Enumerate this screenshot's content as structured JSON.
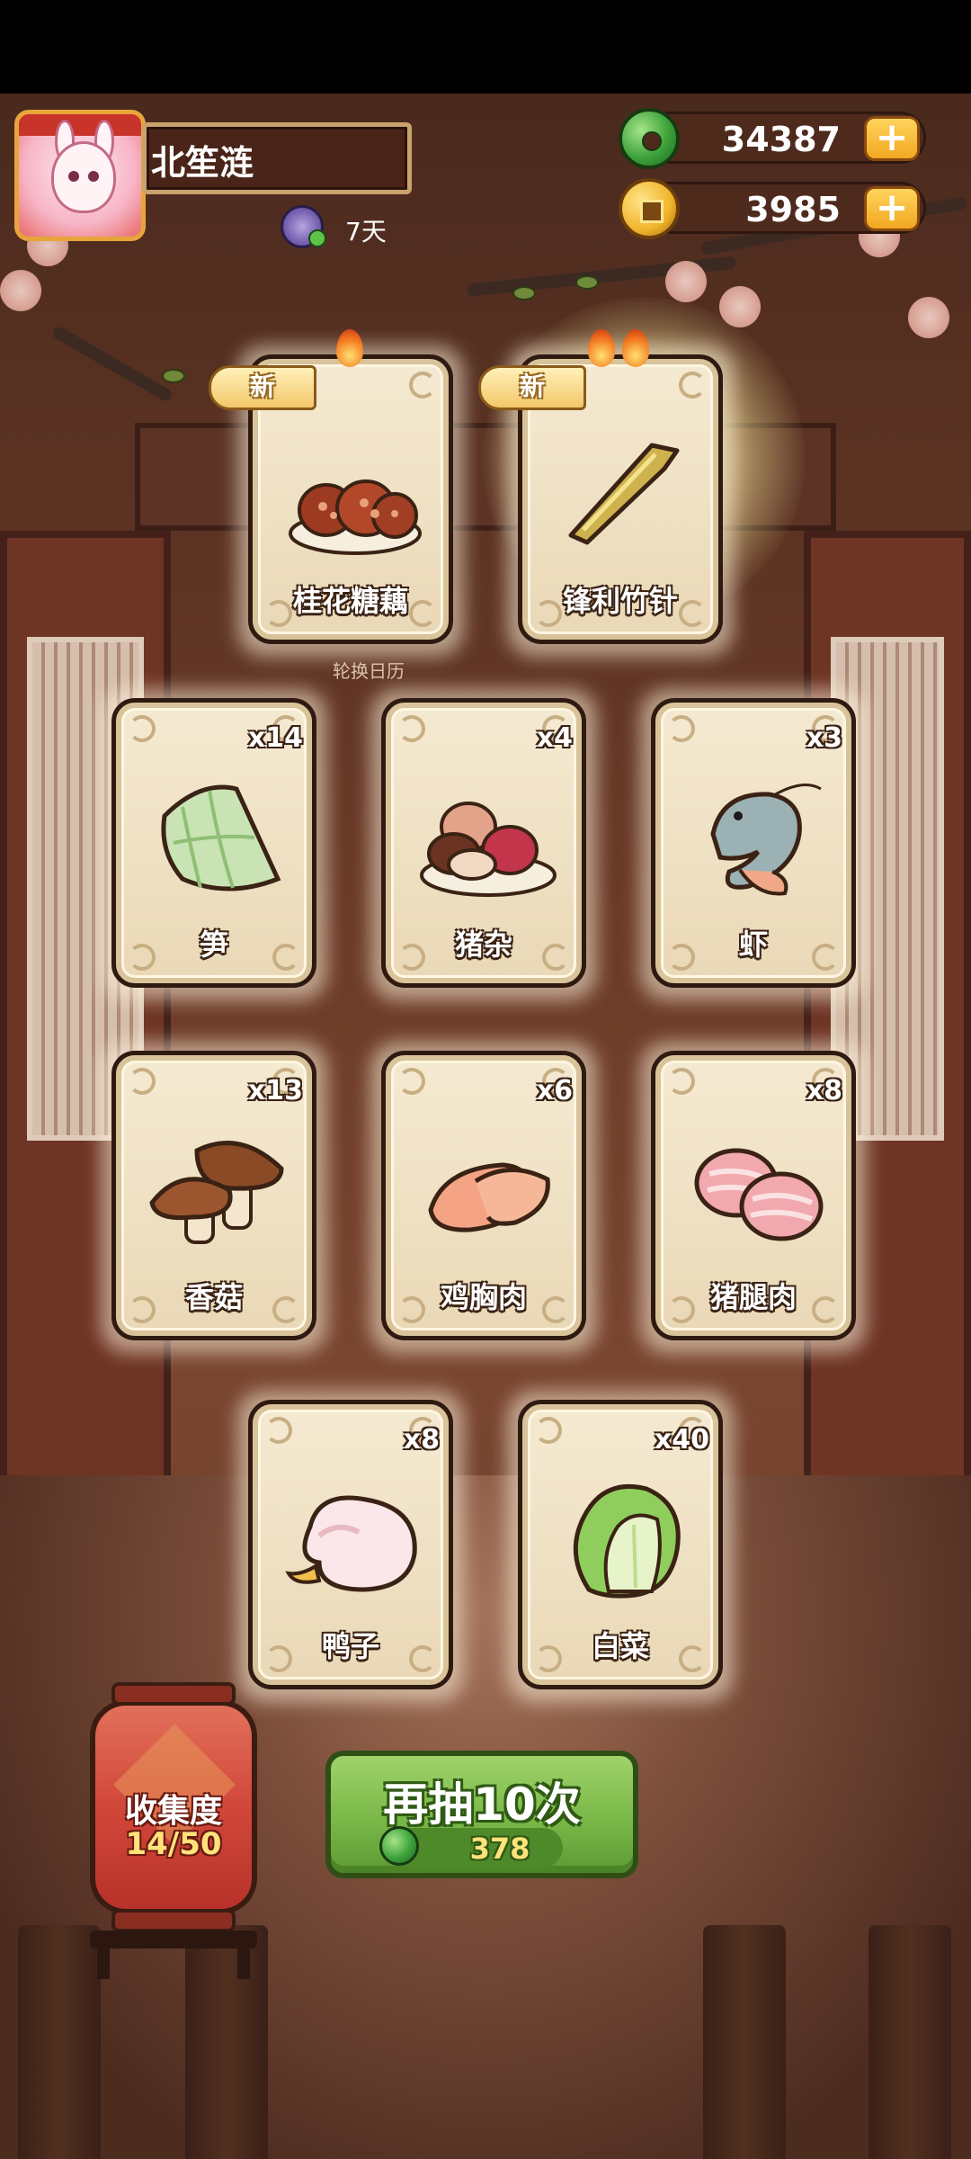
{
  "player": {
    "name": "北笙涟",
    "streak": "7天"
  },
  "currencies": {
    "jade": "34387",
    "coins": "3985",
    "plus_symbol": "+"
  },
  "draw_results": {
    "new_badge_text": "新",
    "calendar_hint": "轮换日历",
    "featured": [
      {
        "label": "桂花糖藕",
        "new": true,
        "art": "lotus-root-icon"
      },
      {
        "label": "锋利竹针",
        "new": true,
        "art": "bamboo-needle-icon"
      }
    ],
    "items": [
      {
        "label": "笋",
        "qty": "x14",
        "art": "bamboo-shoot-icon"
      },
      {
        "label": "猪杂",
        "qty": "x4",
        "art": "pork-offal-icon"
      },
      {
        "label": "虾",
        "qty": "x3",
        "art": "shrimp-icon"
      },
      {
        "label": "香菇",
        "qty": "x13",
        "art": "mushroom-icon"
      },
      {
        "label": "鸡胸肉",
        "qty": "x6",
        "art": "chicken-breast-icon"
      },
      {
        "label": "猪腿肉",
        "qty": "x8",
        "art": "pork-leg-icon"
      },
      {
        "label": "鸭子",
        "qty": "x8",
        "art": "duck-icon"
      },
      {
        "label": "白菜",
        "qty": "x40",
        "art": "cabbage-icon"
      }
    ]
  },
  "collection": {
    "title": "收集度",
    "progress": "14/50"
  },
  "draw_again": {
    "label": "再抽10次",
    "cost": "378",
    "cost_icon": "jade-coin-icon"
  },
  "colors": {
    "accent_green": "#79b848",
    "lantern_red": "#d1473a",
    "gold": "#f2a821",
    "card_bg": "#f5ead2"
  }
}
